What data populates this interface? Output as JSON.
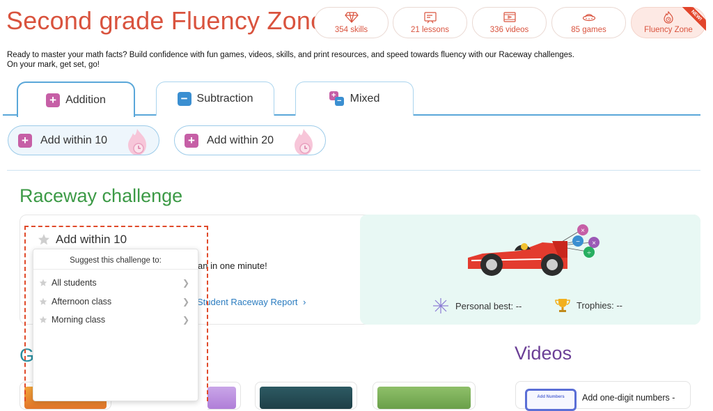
{
  "page_title": "Second grade Fluency Zone",
  "stats": [
    {
      "label": "354 skills",
      "icon": "gem-icon"
    },
    {
      "label": "21 lessons",
      "icon": "lesson-board-icon"
    },
    {
      "label": "336 videos",
      "icon": "video-icon"
    },
    {
      "label": "85 games",
      "icon": "ufo-icon"
    },
    {
      "label": "Fluency Zone",
      "icon": "flame-clock-icon",
      "badge": "NEW!"
    }
  ],
  "intro": {
    "line1": "Ready to master your math facts? Build confidence with fun games, videos, skills, and print resources, and speed towards fluency with our Raceway challenges.",
    "line2": "On your mark, get set, go!"
  },
  "tabs": [
    {
      "label": "Addition",
      "symbol": "+",
      "active": true
    },
    {
      "label": "Subtraction",
      "symbol": "−",
      "active": false
    },
    {
      "label": "Mixed",
      "active": false
    }
  ],
  "pills": [
    {
      "label": "Add within 10",
      "symbol": "+"
    },
    {
      "label": "Add within 20",
      "symbol": "+"
    }
  ],
  "raceway": {
    "title": "Raceway challenge",
    "challenge_name": "Add within 10",
    "partial_text": "an in one minute!",
    "report_link": "Student Raceway Report",
    "report_chevron": "›",
    "personal_best": "Personal best: --",
    "trophies": "Trophies: --",
    "popup": {
      "heading": "Suggest this challenge to:",
      "items": [
        "All students",
        "Afternoon class",
        "Morning class"
      ]
    }
  },
  "games_title_partial": "G",
  "videos": {
    "title": "Videos",
    "first_item": "Add one-digit numbers -",
    "thumb_text": "Add Numbers"
  },
  "colors": {
    "brand_orange": "#d9533e",
    "tab_blue": "#5aa7d9",
    "addition_pink": "#c65fa6",
    "subtraction_blue": "#3b8fd1",
    "raceway_green": "#3c9a46",
    "videos_purple": "#6b3f96",
    "highlight_red": "#e04a2a"
  }
}
